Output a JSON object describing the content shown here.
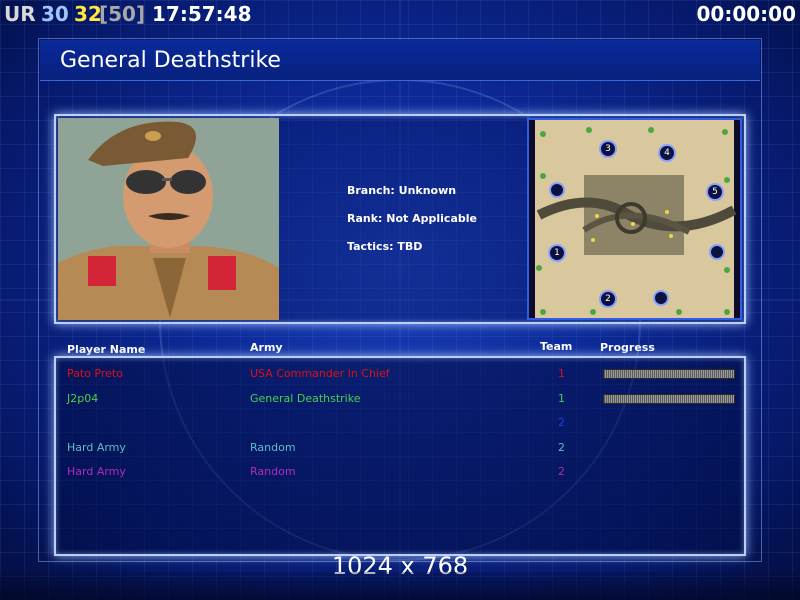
{
  "hud": {
    "ur_label": "UR",
    "value_a": "30",
    "value_b": "32",
    "value_c": "[50]",
    "clock": "17:57:48",
    "timer": "00:00:00"
  },
  "title": "General Deathstrike",
  "general_info": {
    "branch": "Branch: Unknown",
    "rank": "Rank: Not Applicable",
    "tactics": "Tactics: TBD"
  },
  "minimap": {
    "slots": [
      "1",
      "2",
      "3",
      "4",
      "5"
    ]
  },
  "table": {
    "headers": {
      "player": "Player Name",
      "army": "Army",
      "team": "Team",
      "progress": "Progress"
    },
    "rows": [
      {
        "name": "Pato Preto",
        "army": "USA Commander In Chief",
        "team": "1",
        "color": "#e01010",
        "progress": 1.0
      },
      {
        "name": "J2p04",
        "army": "General Deathstrike",
        "team": "1",
        "color": "#4ad04a",
        "progress": 1.0
      },
      {
        "name": "",
        "army": "",
        "team": "2",
        "color": "#1a3fd8",
        "progress": null
      },
      {
        "name": "Hard Army",
        "army": "Random",
        "team": "2",
        "color": "#5fbcc6",
        "progress": null
      },
      {
        "name": "Hard Army",
        "army": "Random",
        "team": "2",
        "color": "#b02cb8",
        "progress": null
      }
    ]
  },
  "resolution": "1024 x 768",
  "colors": {
    "hud_grey": "#d8d8d8",
    "hud_blue": "#9fc4ff",
    "hud_yellow": "#ffe640",
    "hud_darkgrey": "#a8a8a8"
  }
}
